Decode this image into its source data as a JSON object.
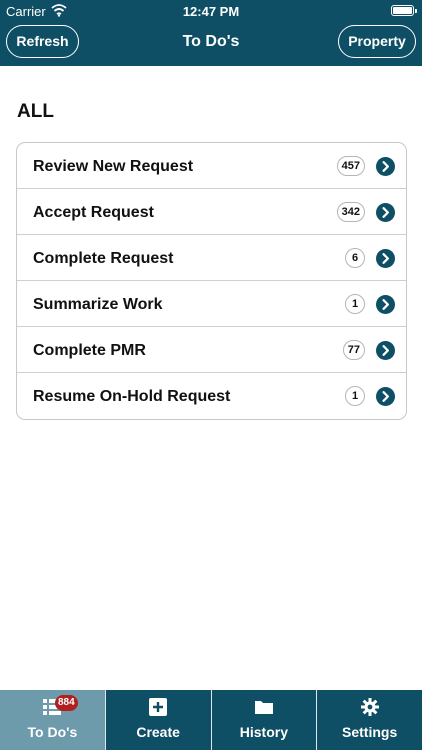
{
  "status_bar": {
    "carrier": "Carrier",
    "time": "12:47 PM"
  },
  "nav": {
    "left_button": "Refresh",
    "title": "To Do's",
    "right_button": "Property"
  },
  "section": {
    "title": "ALL"
  },
  "items": [
    {
      "label": "Review New Request",
      "count": "457"
    },
    {
      "label": "Accept Request",
      "count": "342"
    },
    {
      "label": "Complete Request",
      "count": "6"
    },
    {
      "label": "Summarize Work",
      "count": "1"
    },
    {
      "label": "Complete PMR",
      "count": "77"
    },
    {
      "label": "Resume On-Hold Request",
      "count": "1"
    }
  ],
  "tabs": [
    {
      "label": "To Do's",
      "icon": "list-icon",
      "badge": "884",
      "active": true
    },
    {
      "label": "Create",
      "icon": "plus-square-icon",
      "active": false
    },
    {
      "label": "History",
      "icon": "folder-icon",
      "active": false
    },
    {
      "label": "Settings",
      "icon": "gear-icon",
      "active": false
    }
  ],
  "colors": {
    "header": "#0f4f65",
    "active_tab": "#6e9bab",
    "badge": "#b21f1f",
    "arrow": "#0f4f65"
  }
}
